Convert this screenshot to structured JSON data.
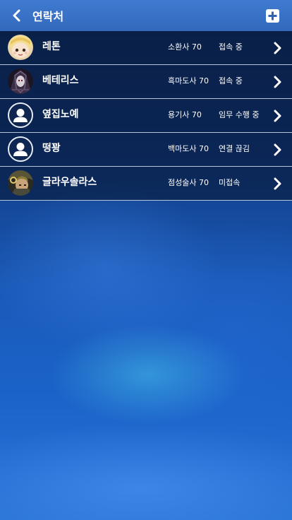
{
  "header": {
    "title": "연락처"
  },
  "contacts": [
    {
      "name": "레톤",
      "job": "소환사 70",
      "status": "접속 중",
      "avatar": "portrait-blonde-icon"
    },
    {
      "name": "베테리스",
      "job": "흑마도사 70",
      "status": "접속 중",
      "avatar": "portrait-dark-icon"
    },
    {
      "name": "옆집노예",
      "job": "용기사 70",
      "status": "임무 수행 중",
      "avatar": "default-user-icon"
    },
    {
      "name": "떵꽝",
      "job": "백마도사 70",
      "status": "연결 끊김",
      "avatar": "default-user-icon"
    },
    {
      "name": "글라우솔라스",
      "job": "점성술사 70",
      "status": "미접속",
      "avatar": "portrait-armored-icon"
    }
  ],
  "colors": {
    "header_bg": "#3a72c8",
    "row_bg": "#0a1a3a",
    "divider": "#d7e1f0",
    "text": "#ffffff"
  }
}
